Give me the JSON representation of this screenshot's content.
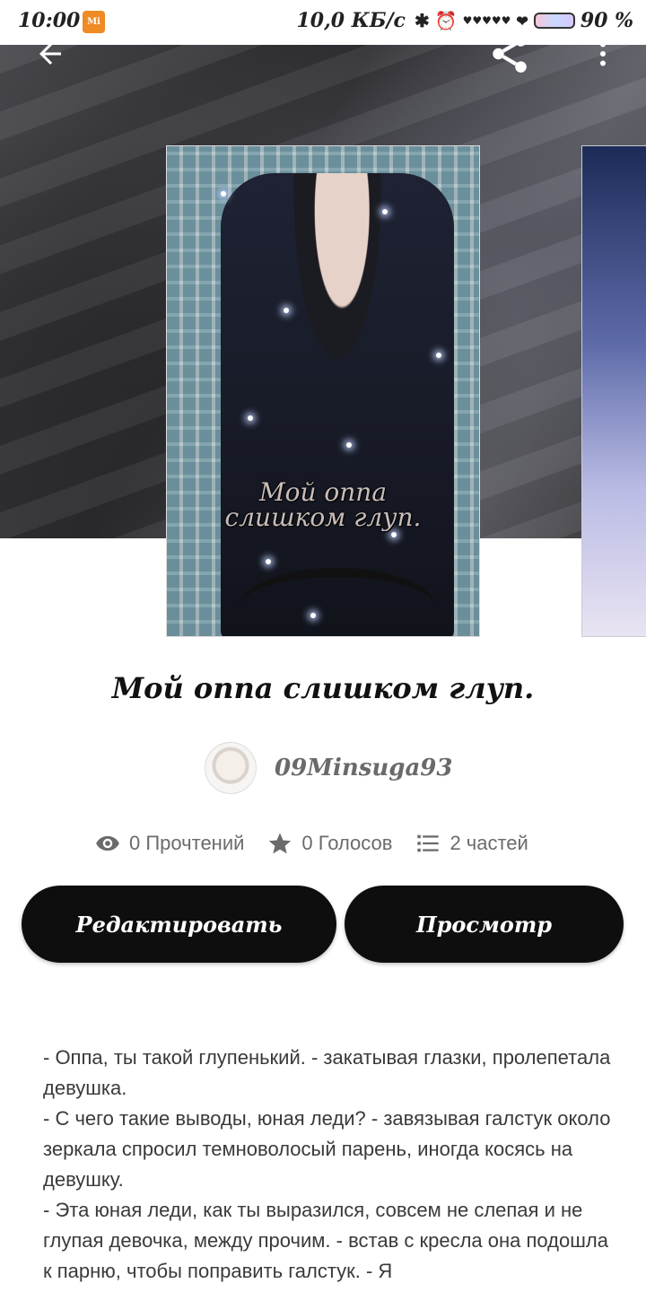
{
  "status_bar": {
    "time": "10:00",
    "app_badge": "Mi",
    "network_speed": "10,0 КБ/с",
    "battery_percent": "90 %"
  },
  "header": {
    "back_icon": "arrow-left-icon",
    "share_icon": "share-icon",
    "more_icon": "more-vertical-icon"
  },
  "cover": {
    "caption_line1": "Мой оппа",
    "caption_line2": "слишком глуп."
  },
  "story": {
    "title": "Мой оппа слишком глуп.",
    "author": "09Minsuga93",
    "stats": {
      "reads": "0 Прочтений",
      "votes": "0 Голосов",
      "parts": "2 частей"
    }
  },
  "actions": {
    "edit_label": "Редактировать",
    "preview_label": "Просмотр"
  },
  "description": [
    "- Оппа, ты такой глупенький. - закатывая глазки, пролепетала девушка.",
    "- С чего такие выводы, юная леди? - завязывая галстук около зеркала спросил темноволосый парень, иногда косясь на девушку.",
    "- Эта юная леди, как ты выразился, совсем не слепая и не глупая девочка, между прочим. - встав с кресла она подошла к парню, чтобы поправить галстук. - Я"
  ],
  "colors": {
    "button_bg": "#0e0e0e",
    "button_text": "#ffffff",
    "stat_text": "#6b6b6b",
    "author_text": "#6a6a6a"
  }
}
